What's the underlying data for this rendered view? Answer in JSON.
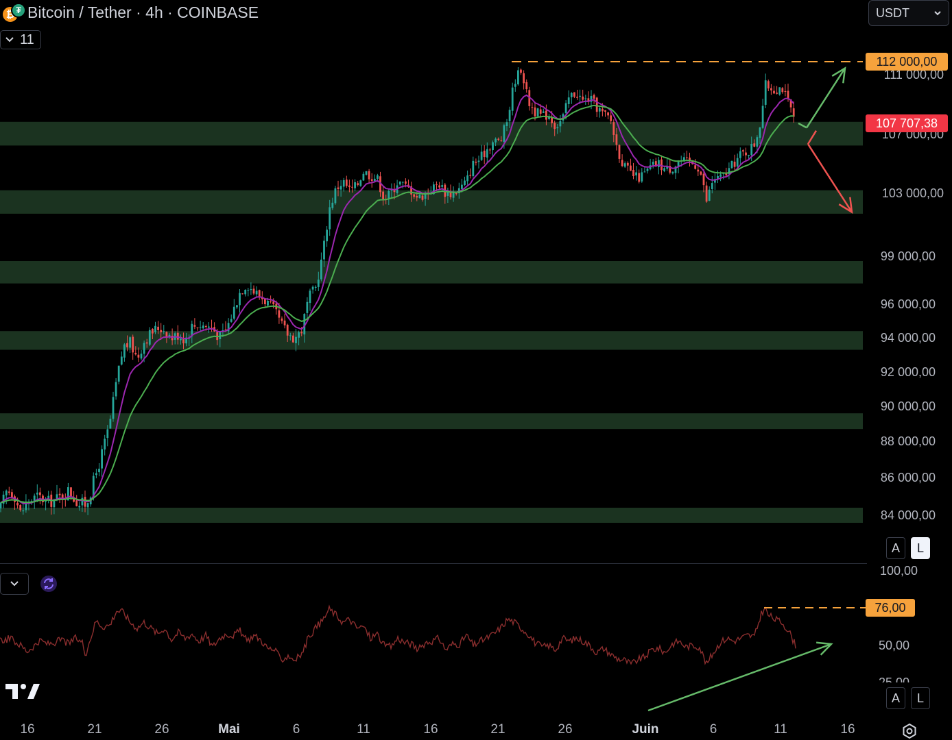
{
  "header": {
    "symbol_title": "Bitcoin / Tether · 4h · COINBASE",
    "indicator_count": "11",
    "currency": "USDT"
  },
  "icons": {
    "btc": "bitcoin-icon",
    "usdt": "tether-icon",
    "collapse": "chevron-down-icon",
    "refresh": "refresh-icon",
    "settings": "gear-icon",
    "logo": "tradingview-logo"
  },
  "buttons": {
    "auto": "A",
    "log": "L"
  },
  "colors": {
    "zone": "#1b3320",
    "up": "#26a69a",
    "down": "#ef5350",
    "ema_fast": "#9c27b0",
    "ema_slow": "#4caf50",
    "rsi": "#8b2e2e",
    "orange": "#f6a23c",
    "arrow_up": "#66bb6a",
    "arrow_down": "#ef5350"
  },
  "chart_data": [
    {
      "type": "candlestick",
      "title": "Bitcoin / Tether · 4h · COINBASE",
      "price_axis_labels": [
        "111 000,00",
        "107 000,00",
        "103 000,00",
        "99 000,00",
        "96 000,00",
        "94 000,00",
        "92 000,00",
        "90 000,00",
        "88 000,00",
        "86 000,00",
        "84 000,00"
      ],
      "date_axis_labels": [
        "16",
        "21",
        "26",
        "Mai",
        "6",
        "11",
        "16",
        "21",
        "26",
        "Juin",
        "6",
        "11",
        "16"
      ],
      "last_price": "107 707,38",
      "resistance_level": "112 000,00",
      "support_zones": [
        [
          106200,
          107800
        ],
        [
          101700,
          103200
        ],
        [
          97300,
          98700
        ],
        [
          93300,
          94400
        ],
        [
          88700,
          89600
        ],
        [
          83600,
          84400
        ]
      ],
      "close_path": [
        [
          0,
          84300
        ],
        [
          10,
          85300
        ],
        [
          20,
          85200
        ],
        [
          30,
          84100
        ],
        [
          40,
          84700
        ],
        [
          55,
          85000
        ],
        [
          70,
          84700
        ],
        [
          85,
          84900
        ],
        [
          100,
          85300
        ],
        [
          115,
          84600
        ],
        [
          125,
          84600
        ],
        [
          130,
          85000
        ],
        [
          140,
          86200
        ],
        [
          150,
          87500
        ],
        [
          160,
          89000
        ],
        [
          170,
          91500
        ],
        [
          180,
          93500
        ],
        [
          190,
          93700
        ],
        [
          200,
          92800
        ],
        [
          210,
          93800
        ],
        [
          220,
          94300
        ],
        [
          230,
          94600
        ],
        [
          240,
          94500
        ],
        [
          250,
          94000
        ],
        [
          260,
          94200
        ],
        [
          270,
          93900
        ],
        [
          280,
          94700
        ],
        [
          290,
          94800
        ],
        [
          300,
          94700
        ],
        [
          310,
          94600
        ],
        [
          320,
          94000
        ],
        [
          330,
          94500
        ],
        [
          340,
          95600
        ],
        [
          350,
          96800
        ],
        [
          360,
          97300
        ],
        [
          370,
          96800
        ],
        [
          380,
          96500
        ],
        [
          390,
          96100
        ],
        [
          400,
          95600
        ],
        [
          410,
          94800
        ],
        [
          420,
          94200
        ],
        [
          430,
          94000
        ],
        [
          440,
          94500
        ],
        [
          450,
          96400
        ],
        [
          460,
          97000
        ],
        [
          470,
          99000
        ],
        [
          480,
          102000
        ],
        [
          490,
          103300
        ],
        [
          500,
          103800
        ],
        [
          510,
          103200
        ],
        [
          520,
          103500
        ],
        [
          530,
          104500
        ],
        [
          540,
          104200
        ],
        [
          550,
          104000
        ],
        [
          560,
          102700
        ],
        [
          570,
          103000
        ],
        [
          580,
          103800
        ],
        [
          590,
          103500
        ],
        [
          600,
          103200
        ],
        [
          610,
          102700
        ],
        [
          620,
          103000
        ],
        [
          630,
          103300
        ],
        [
          640,
          103700
        ],
        [
          650,
          103000
        ],
        [
          660,
          103000
        ],
        [
          670,
          103300
        ],
        [
          680,
          103800
        ],
        [
          690,
          105000
        ],
        [
          700,
          105300
        ],
        [
          710,
          106000
        ],
        [
          720,
          106500
        ],
        [
          730,
          106500
        ],
        [
          740,
          108000
        ],
        [
          750,
          110600
        ],
        [
          760,
          111500
        ],
        [
          770,
          109200
        ],
        [
          780,
          108500
        ],
        [
          790,
          108200
        ],
        [
          800,
          108300
        ],
        [
          810,
          107500
        ],
        [
          820,
          108000
        ],
        [
          830,
          109500
        ],
        [
          840,
          109800
        ],
        [
          850,
          109200
        ],
        [
          860,
          109400
        ],
        [
          870,
          108800
        ],
        [
          880,
          108300
        ],
        [
          890,
          108000
        ],
        [
          900,
          106000
        ],
        [
          910,
          104800
        ],
        [
          920,
          104300
        ],
        [
          930,
          104000
        ],
        [
          940,
          104300
        ],
        [
          950,
          104800
        ],
        [
          960,
          105000
        ],
        [
          970,
          104600
        ],
        [
          980,
          104700
        ],
        [
          990,
          105200
        ],
        [
          1000,
          105100
        ],
        [
          1010,
          105000
        ],
        [
          1020,
          104700
        ],
        [
          1030,
          102500
        ],
        [
          1040,
          104000
        ],
        [
          1050,
          104000
        ],
        [
          1060,
          104400
        ],
        [
          1070,
          105000
        ],
        [
          1080,
          105600
        ],
        [
          1090,
          105800
        ],
        [
          1100,
          106300
        ],
        [
          1110,
          108000
        ],
        [
          1115,
          110300
        ],
        [
          1120,
          110200
        ],
        [
          1130,
          110000
        ],
        [
          1140,
          110200
        ],
        [
          1150,
          109000
        ],
        [
          1160,
          107700
        ]
      ],
      "scenario_arrows": [
        {
          "direction": "up",
          "from": [
            1176,
            107400
          ],
          "to": [
            1232,
            112500
          ]
        },
        {
          "direction": "down",
          "from": [
            1178,
            106300
          ],
          "to": [
            1242,
            101800
          ]
        }
      ]
    },
    {
      "type": "line",
      "series": [
        {
          "name": "",
          "values": []
        }
      ],
      "axis_labels": [
        "100,00",
        "50,00",
        "25,00"
      ],
      "level_label": "76,00",
      "rsi_path": [
        [
          0,
          53
        ],
        [
          15,
          55
        ],
        [
          30,
          50
        ],
        [
          40,
          46
        ],
        [
          50,
          50
        ],
        [
          60,
          53
        ],
        [
          70,
          51
        ],
        [
          80,
          52
        ],
        [
          90,
          54
        ],
        [
          100,
          51
        ],
        [
          110,
          55
        ],
        [
          120,
          52
        ],
        [
          125,
          44
        ],
        [
          130,
          52
        ],
        [
          140,
          67
        ],
        [
          150,
          63
        ],
        [
          160,
          64
        ],
        [
          170,
          74
        ],
        [
          180,
          73
        ],
        [
          190,
          66
        ],
        [
          200,
          62
        ],
        [
          210,
          66
        ],
        [
          220,
          62
        ],
        [
          230,
          58
        ],
        [
          240,
          62
        ],
        [
          250,
          54
        ],
        [
          260,
          59
        ],
        [
          270,
          55
        ],
        [
          280,
          58
        ],
        [
          290,
          53
        ],
        [
          300,
          57
        ],
        [
          310,
          49
        ],
        [
          320,
          55
        ],
        [
          330,
          58
        ],
        [
          340,
          57
        ],
        [
          350,
          60
        ],
        [
          360,
          53
        ],
        [
          370,
          57
        ],
        [
          380,
          54
        ],
        [
          390,
          48
        ],
        [
          400,
          47
        ],
        [
          410,
          40
        ],
        [
          420,
          43
        ],
        [
          430,
          40
        ],
        [
          440,
          44
        ],
        [
          450,
          56
        ],
        [
          460,
          62
        ],
        [
          470,
          67
        ],
        [
          480,
          75
        ],
        [
          490,
          71
        ],
        [
          500,
          66
        ],
        [
          510,
          68
        ],
        [
          520,
          62
        ],
        [
          530,
          63
        ],
        [
          540,
          55
        ],
        [
          550,
          58
        ],
        [
          560,
          50
        ],
        [
          570,
          49
        ],
        [
          580,
          55
        ],
        [
          590,
          52
        ],
        [
          600,
          51
        ],
        [
          610,
          47
        ],
        [
          620,
          52
        ],
        [
          630,
          53
        ],
        [
          640,
          55
        ],
        [
          650,
          47
        ],
        [
          660,
          51
        ],
        [
          670,
          51
        ],
        [
          680,
          57
        ],
        [
          690,
          50
        ],
        [
          700,
          53
        ],
        [
          710,
          55
        ],
        [
          720,
          58
        ],
        [
          730,
          62
        ],
        [
          740,
          68
        ],
        [
          750,
          66
        ],
        [
          760,
          62
        ],
        [
          770,
          58
        ],
        [
          780,
          52
        ],
        [
          790,
          49
        ],
        [
          800,
          50
        ],
        [
          810,
          47
        ],
        [
          820,
          55
        ],
        [
          830,
          53
        ],
        [
          840,
          55
        ],
        [
          850,
          53
        ],
        [
          860,
          50
        ],
        [
          870,
          45
        ],
        [
          880,
          48
        ],
        [
          890,
          44
        ],
        [
          900,
          41
        ],
        [
          910,
          40
        ],
        [
          920,
          37
        ],
        [
          930,
          40
        ],
        [
          940,
          42
        ],
        [
          950,
          47
        ],
        [
          960,
          48
        ],
        [
          970,
          45
        ],
        [
          980,
          51
        ],
        [
          990,
          53
        ],
        [
          1000,
          49
        ],
        [
          1010,
          50
        ],
        [
          1020,
          49
        ],
        [
          1030,
          37
        ],
        [
          1040,
          45
        ],
        [
          1050,
          52
        ],
        [
          1060,
          55
        ],
        [
          1070,
          53
        ],
        [
          1080,
          55
        ],
        [
          1090,
          57
        ],
        [
          1100,
          56
        ],
        [
          1110,
          72
        ],
        [
          1115,
          76
        ],
        [
          1120,
          71
        ],
        [
          1130,
          68
        ],
        [
          1140,
          66
        ],
        [
          1150,
          60
        ],
        [
          1160,
          50
        ]
      ],
      "divergence_arrow": {
        "from": [
          945,
          1037
        ],
        "to": [
          1212,
          940
        ]
      }
    }
  ]
}
